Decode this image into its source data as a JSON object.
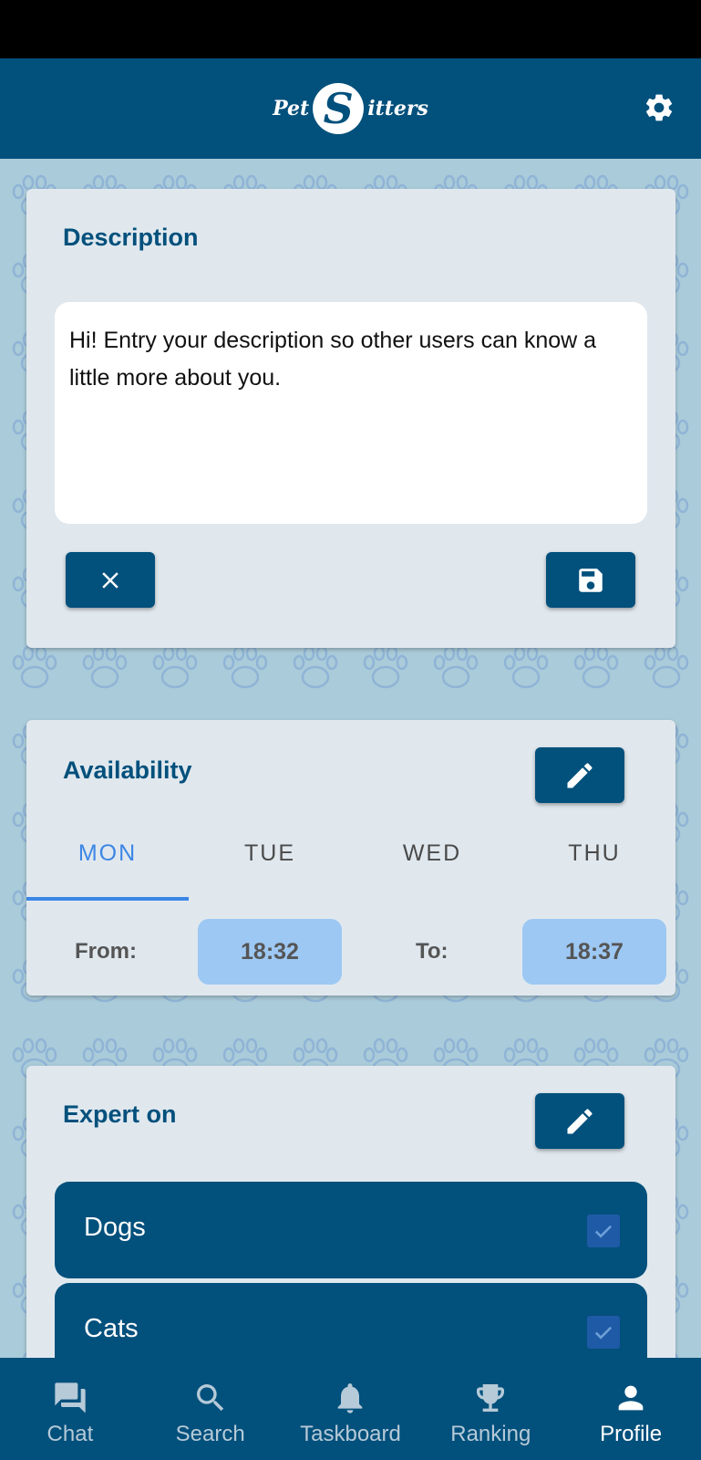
{
  "header": {
    "logo_left": "Pet",
    "logo_letter": "S",
    "logo_right": "itters",
    "settings_icon": "gear-icon"
  },
  "description": {
    "title": "Description",
    "text": "Hi! Entry your description so other users can know a little more about you.",
    "cancel_icon": "close-icon",
    "save_icon": "floppy-disk-icon"
  },
  "availability": {
    "title": "Availability",
    "edit_icon": "pencil-icon",
    "tabs": [
      {
        "label": "MON",
        "active": true
      },
      {
        "label": "TUE",
        "active": false
      },
      {
        "label": "WED",
        "active": false
      },
      {
        "label": "THU",
        "active": false
      }
    ],
    "from_label": "From:",
    "from_value": "18:32",
    "to_label": "To:",
    "to_value": "18:37"
  },
  "expert": {
    "title": "Expert on",
    "edit_icon": "pencil-icon",
    "items": [
      {
        "label": "Dogs",
        "checked": true
      },
      {
        "label": "Cats",
        "checked": true
      }
    ]
  },
  "nav": {
    "items": [
      {
        "label": "Chat",
        "icon": "chat-icon",
        "active": false
      },
      {
        "label": "Search",
        "icon": "search-icon",
        "active": false
      },
      {
        "label": "Taskboard",
        "icon": "bell-icon",
        "active": false
      },
      {
        "label": "Ranking",
        "icon": "trophy-icon",
        "active": false
      },
      {
        "label": "Profile",
        "icon": "person-icon",
        "active": true
      }
    ]
  },
  "colors": {
    "primary": "#02507c",
    "accent": "#3c86e6",
    "background": "#aacbd9",
    "card": "#e0e8ee",
    "time_chip": "#9dc8f3"
  }
}
